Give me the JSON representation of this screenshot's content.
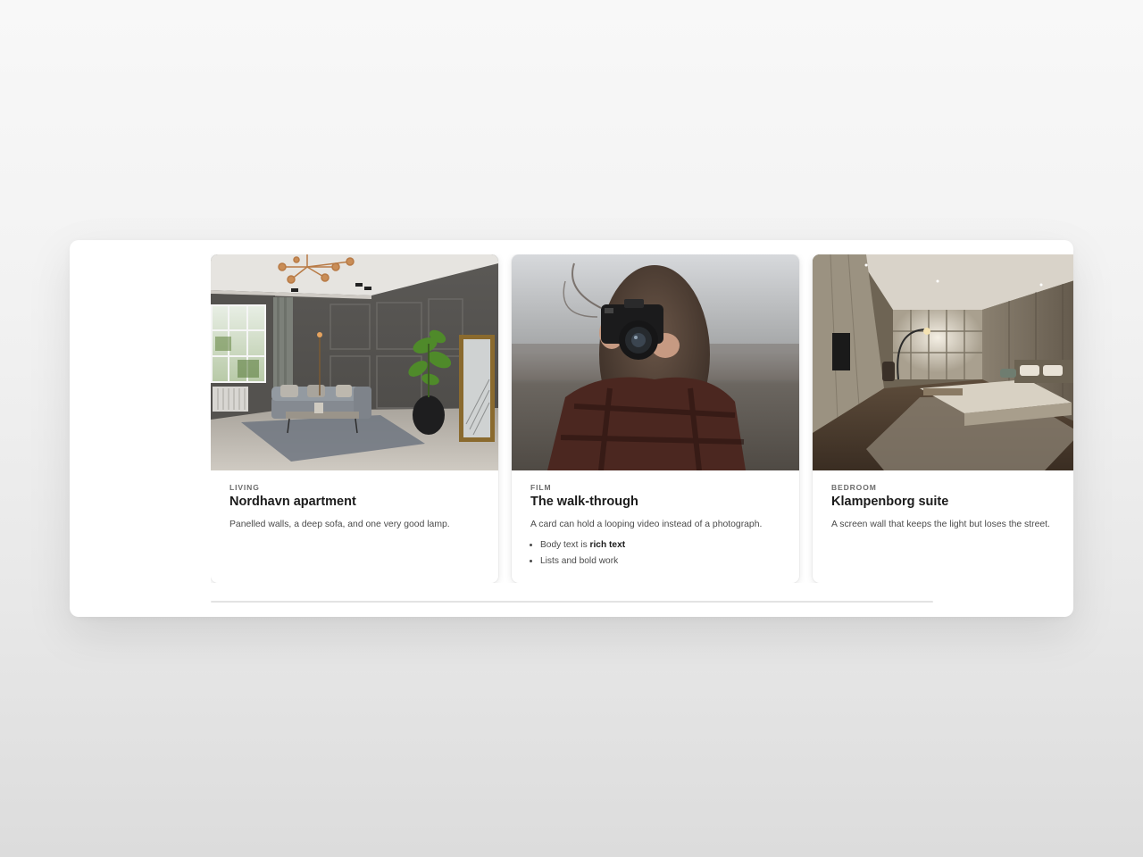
{
  "carousel": {
    "cards": [
      {
        "eyebrow": "LIVING",
        "title": "Nordhavn apartment",
        "description": "Panelled walls, a deep sofa, and one very good lamp."
      },
      {
        "eyebrow": "FILM",
        "title": "The walk-through",
        "description": "A card can hold a looping video instead of a photograph.",
        "list": [
          {
            "prefix": "Body text is ",
            "bold": "rich text"
          },
          {
            "prefix": "Lists and bold work",
            "bold": ""
          }
        ]
      },
      {
        "eyebrow": "BEDROOM",
        "title": "Klampenborg suite",
        "description": "A screen wall that keeps the light but loses the street."
      }
    ]
  },
  "colors": {
    "panel": "#ffffff",
    "text_primary": "#1b1b1b",
    "text_secondary": "#4a4a4a",
    "eyebrow": "#6b6b6b"
  }
}
